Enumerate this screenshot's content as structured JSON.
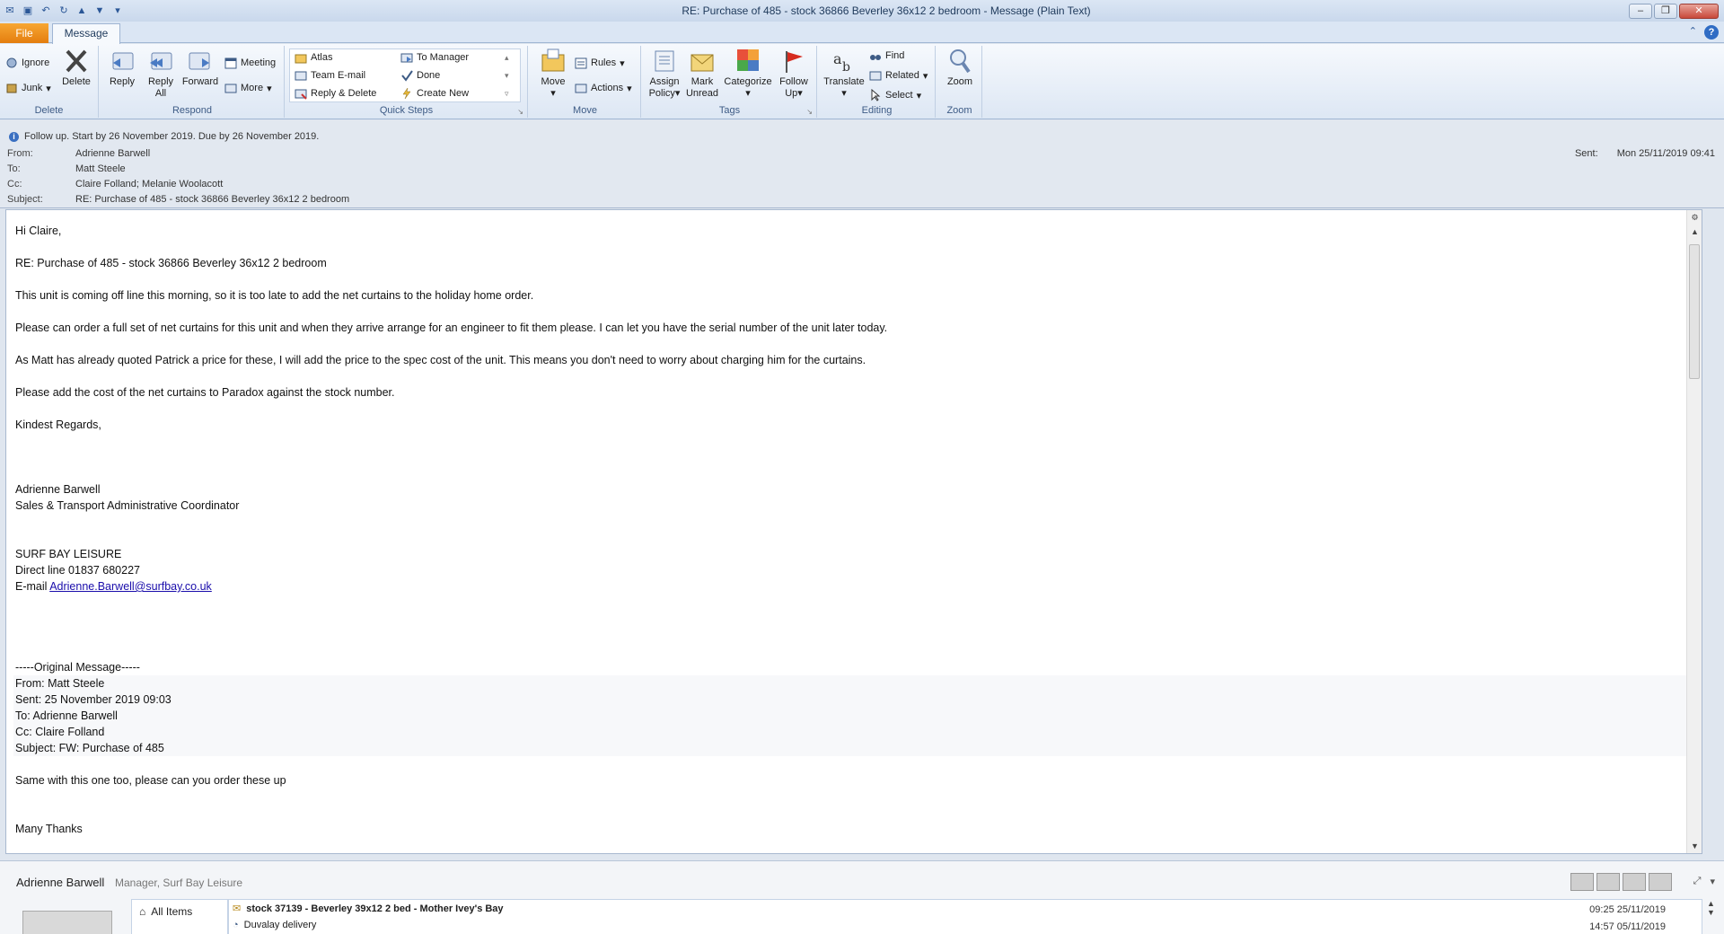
{
  "window": {
    "title": "RE: Purchase of 485 - stock 36866 Beverley 36x12 2 bedroom  -  Message (Plain Text)"
  },
  "tabs": {
    "file": "File",
    "message": "Message"
  },
  "ribbon": {
    "delete": {
      "ignore": "Ignore",
      "junk": "Junk",
      "delete": "Delete",
      "label": "Delete"
    },
    "respond": {
      "reply": "Reply",
      "reply_all_1": "Reply",
      "reply_all_2": "All",
      "forward": "Forward",
      "meeting": "Meeting",
      "more": "More",
      "label": "Respond"
    },
    "quick_steps": {
      "atlas": "Atlas",
      "team_email": "Team E-mail",
      "reply_delete": "Reply & Delete",
      "to_manager": "To Manager",
      "done": "Done",
      "create_new": "Create New",
      "label": "Quick Steps"
    },
    "move": {
      "move": "Move",
      "rules": "Rules",
      "actions": "Actions",
      "label": "Move"
    },
    "tags": {
      "assign_1": "Assign",
      "assign_2": "Policy",
      "mark_1": "Mark",
      "mark_2": "Unread",
      "categorize": "Categorize",
      "follow_1": "Follow",
      "follow_2": "Up",
      "label": "Tags"
    },
    "editing": {
      "translate": "Translate",
      "find": "Find",
      "related": "Related",
      "select": "Select",
      "label": "Editing"
    },
    "zoom": {
      "zoom": "Zoom",
      "label": "Zoom"
    }
  },
  "header": {
    "followup": "Follow up.  Start by 26 November 2019.  Due by 26 November 2019.",
    "from_label": "From:",
    "from": "Adrienne Barwell",
    "to_label": "To:",
    "to": "Matt Steele",
    "cc_label": "Cc:",
    "cc": "Claire Folland; Melanie Woolacott",
    "subject_label": "Subject:",
    "subject": "RE: Purchase of 485 - stock 36866 Beverley 36x12 2 bedroom",
    "sent_label": "Sent:",
    "sent": "Mon 25/11/2019 09:41"
  },
  "body": {
    "greeting": "Hi Claire,",
    "re_line": "RE: Purchase of 485 - stock 36866 Beverley 36x12 2 bedroom",
    "p1": "This unit is coming off line this morning, so it is too late to add the net curtains to the holiday home order.",
    "p2": "Please can order a full set of  net curtains for this unit and when they arrive arrange for an engineer to fit them please.  I can let you have the serial number of the unit later today.",
    "p3": "As Matt has already quoted Patrick a price for these, I will add the price to the  spec cost of the unit. This means you don't need to worry about charging him for the curtains.",
    "p4": "Please add the cost of the net curtains to Paradox against the stock number.",
    "closing": "Kindest Regards,",
    "sig_name": "Adrienne Barwell",
    "sig_title": "Sales & Transport  Administrative Coordinator",
    "sig_company": "SURF BAY LEISURE",
    "sig_phone": "Direct line 01837 680227",
    "sig_email_prefix": "E-mail ",
    "sig_email": "Adrienne.Barwell@surfbay.co.uk",
    "orig_header": "-----Original Message-----",
    "orig_from": "From: Matt Steele",
    "orig_sent": "Sent: 25 November 2019 09:03",
    "orig_to": "To: Adrienne Barwell",
    "orig_cc": "Cc: Claire Folland",
    "orig_subject": "Subject: FW: Purchase of 485",
    "orig_p1": "Same with this one too, please can you order these up",
    "orig_thanks": "Many Thanks"
  },
  "people_pane": {
    "name": "Adrienne Barwell",
    "role": "Manager, Surf Bay Leisure",
    "nav_all_items": "All Items",
    "items": [
      {
        "subject": "stock 37139 - Beverley 39x12 2 bed - Mother Ivey's Bay",
        "date": "09:25  25/11/2019"
      },
      {
        "subject": "Duvalay delivery",
        "date": "14:57  05/11/2019"
      }
    ]
  }
}
